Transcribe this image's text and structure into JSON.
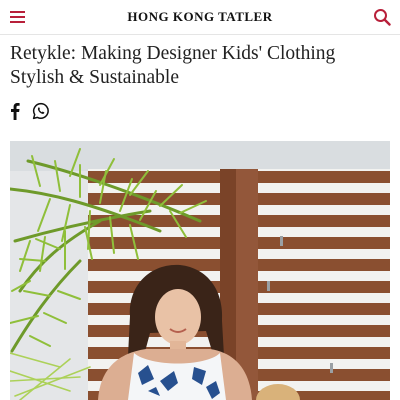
{
  "header": {
    "brand": "HONG KONG TATLER",
    "menu_icon": "hamburger-menu-icon",
    "search_icon": "search-icon",
    "accent_color": "#b8203a"
  },
  "article": {
    "title": "Retykle: Making Designer Kids' Clothing Stylish & Sustainable"
  },
  "share": {
    "icons": [
      "facebook-icon",
      "whatsapp-icon"
    ]
  },
  "hero_image": {
    "icon": "photo"
  }
}
